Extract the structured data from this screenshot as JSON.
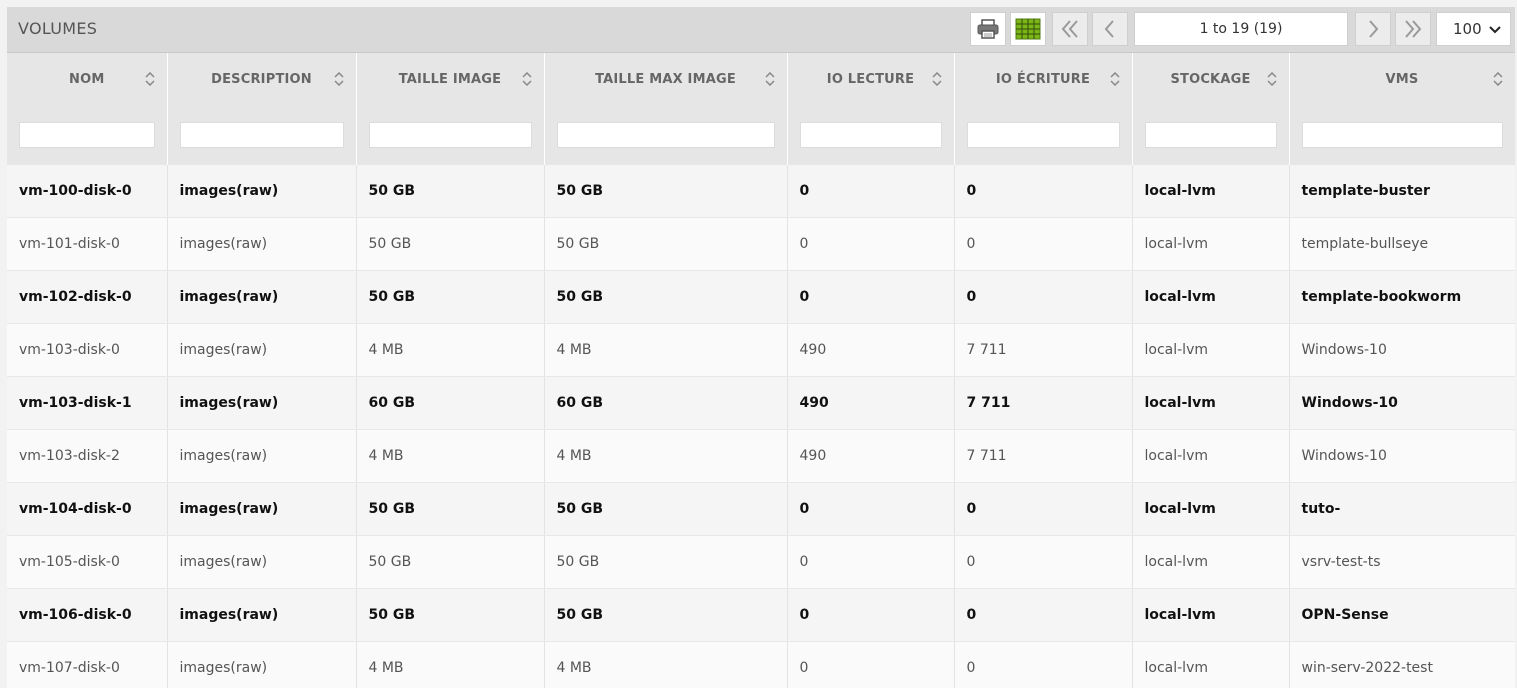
{
  "panel": {
    "title": "VOLUMES"
  },
  "toolbar": {
    "print_icon": "print-icon",
    "columns_icon": "columns-grid-icon",
    "first_icon": "double-chevron-left-icon",
    "prev_icon": "chevron-left-icon",
    "next_icon": "chevron-right-icon",
    "last_icon": "double-chevron-right-icon",
    "page_info": "1 to 19 (19)",
    "page_size": "100",
    "columns_icon_color": "#7cb518"
  },
  "columns": [
    "NOM",
    "DESCRIPTION",
    "TAILLE IMAGE",
    "TAILLE MAX IMAGE",
    "IO LECTURE",
    "IO ÉCRITURE",
    "STOCKAGE",
    "VMS"
  ],
  "rows": [
    [
      "vm-100-disk-0",
      "images(raw)",
      "50 GB",
      "50 GB",
      "0",
      "0",
      "local-lvm",
      "template-buster"
    ],
    [
      "vm-101-disk-0",
      "images(raw)",
      "50 GB",
      "50 GB",
      "0",
      "0",
      "local-lvm",
      "template-bullseye"
    ],
    [
      "vm-102-disk-0",
      "images(raw)",
      "50 GB",
      "50 GB",
      "0",
      "0",
      "local-lvm",
      "template-bookworm"
    ],
    [
      "vm-103-disk-0",
      "images(raw)",
      "4 MB",
      "4 MB",
      "490",
      "7 711",
      "local-lvm",
      "Windows-10"
    ],
    [
      "vm-103-disk-1",
      "images(raw)",
      "60 GB",
      "60 GB",
      "490",
      "7 711",
      "local-lvm",
      "Windows-10"
    ],
    [
      "vm-103-disk-2",
      "images(raw)",
      "4 MB",
      "4 MB",
      "490",
      "7 711",
      "local-lvm",
      "Windows-10"
    ],
    [
      "vm-104-disk-0",
      "images(raw)",
      "50 GB",
      "50 GB",
      "0",
      "0",
      "local-lvm",
      "tuto-"
    ],
    [
      "vm-105-disk-0",
      "images(raw)",
      "50 GB",
      "50 GB",
      "0",
      "0",
      "local-lvm",
      "vsrv-test-ts"
    ],
    [
      "vm-106-disk-0",
      "images(raw)",
      "50 GB",
      "50 GB",
      "0",
      "0",
      "local-lvm",
      "OPN-Sense"
    ],
    [
      "vm-107-disk-0",
      "images(raw)",
      "4 MB",
      "4 MB",
      "0",
      "0",
      "local-lvm",
      "win-serv-2022-test"
    ]
  ]
}
